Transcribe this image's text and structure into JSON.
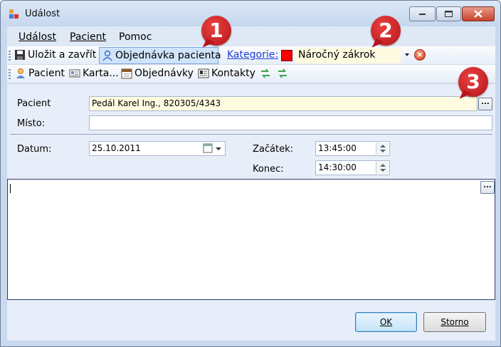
{
  "window": {
    "title": "Událost"
  },
  "menu": {
    "items": [
      "Událost",
      "Pacient",
      "Pomoc"
    ]
  },
  "toolbar1": {
    "save_label": "Uložit a zavřít",
    "order_label": "Objednávka pacienta",
    "category_link": "Kategorie:",
    "category_value": "Náročný zákrok",
    "category_color": "#ff0000"
  },
  "toolbar2": {
    "patient_label": "Pacient",
    "card_label": "Karta...",
    "orders_label": "Objednávky",
    "contacts_label": "Kontakty"
  },
  "form": {
    "patient_label": "Pacient",
    "patient_value": "Pedál Karel Ing., 820305/4343",
    "place_label": "Místo:",
    "place_value": "",
    "date_label": "Datum:",
    "date_value": "25.10.2011",
    "start_label": "Začátek:",
    "start_value": "13:45:00",
    "end_label": "Konec:",
    "end_value": "14:30:00",
    "dots_label": "...",
    "notes_value": ""
  },
  "buttons": {
    "ok": "OK",
    "cancel": "Storno"
  },
  "badges": [
    "1",
    "2",
    "3"
  ]
}
